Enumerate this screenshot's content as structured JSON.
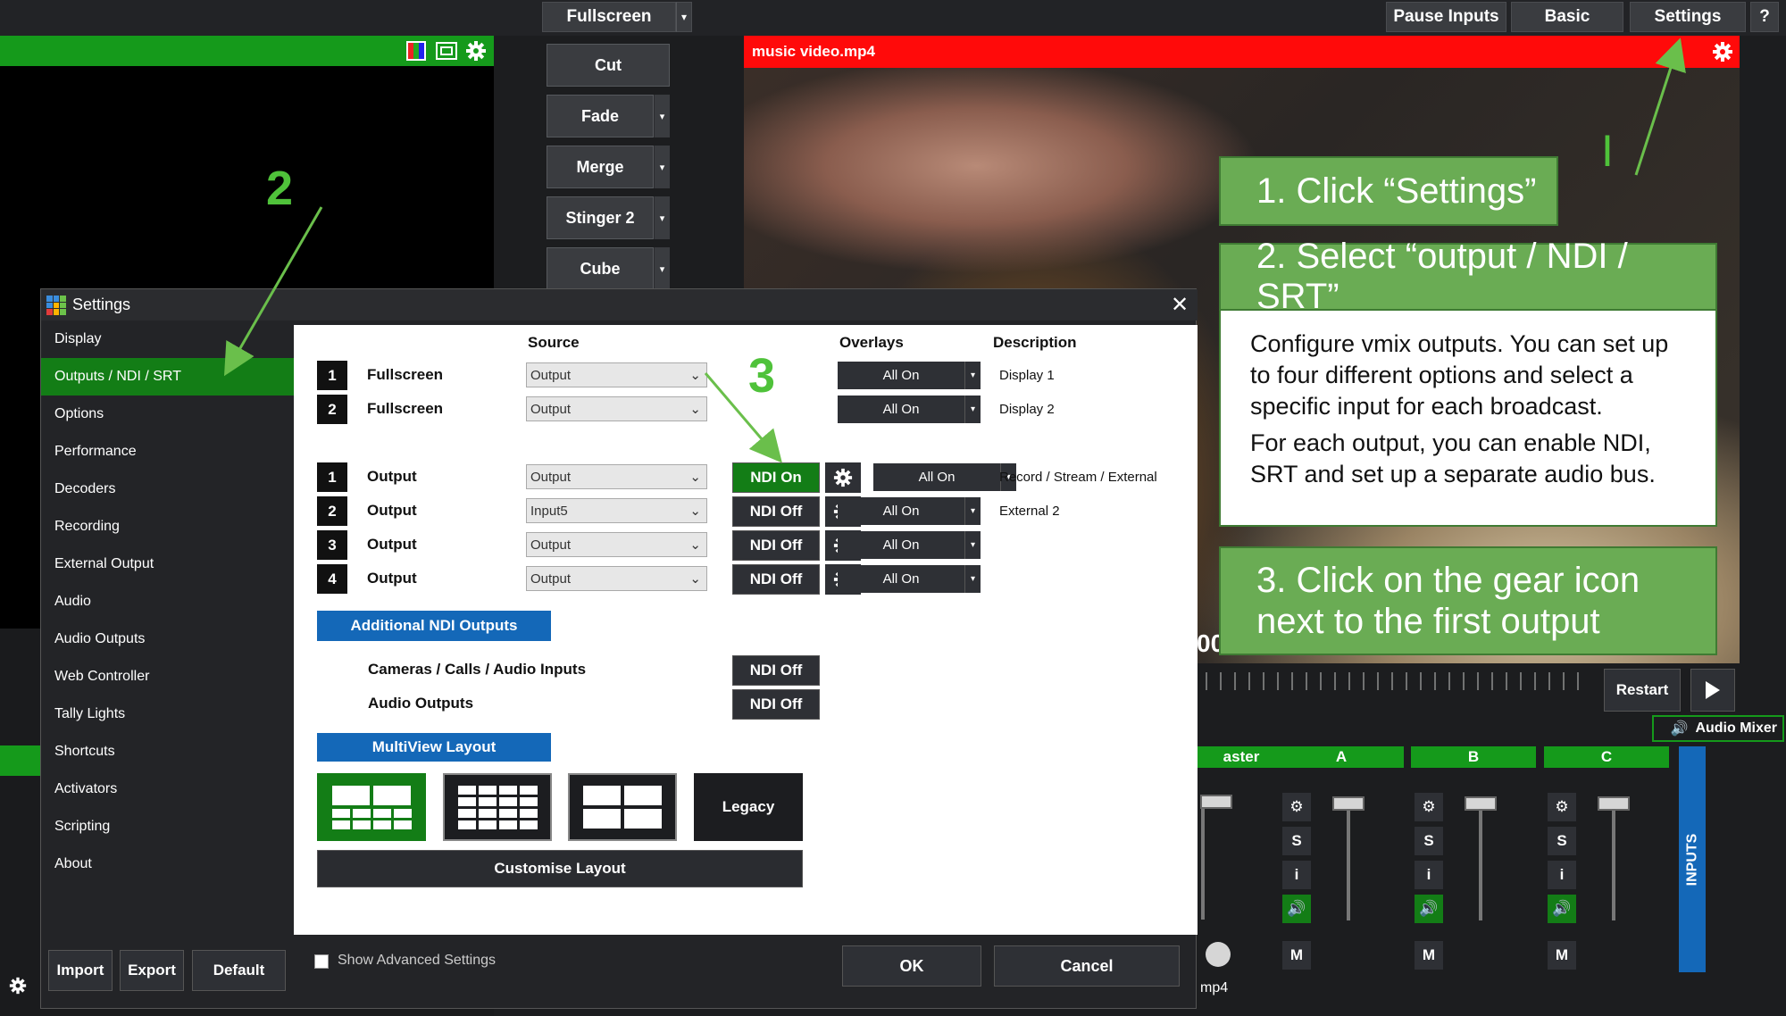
{
  "topbar": {
    "fullscreen_label": "Fullscreen",
    "pause_inputs_label": "Pause Inputs",
    "basic_label": "Basic",
    "settings_label": "Settings",
    "help_label": "?"
  },
  "transitions": [
    "Cut",
    "Fade",
    "Merge",
    "Stinger 2",
    "Cube"
  ],
  "output": {
    "title": "music video.mp4",
    "time_fragment": "00",
    "restart_label": "Restart",
    "audio_mixer_label": "Audio Mixer",
    "bottom_fragment": "mp4"
  },
  "callouts": {
    "step1": "1. Click “Settings”",
    "step2": "2. Select “output / NDI / SRT”",
    "step2_body_1": "Configure vmix outputs. You can set up to four different options and select a specific input for each broadcast.",
    "step2_body_2": "For each output, you can enable NDI, SRT and set up a separate audio bus.",
    "step3": "3. Click on the gear icon next to the first output"
  },
  "markers": {
    "n1": "I",
    "n2": "2",
    "n3": "3"
  },
  "dialog": {
    "title": "Settings",
    "nav": [
      "Display",
      "Outputs / NDI / SRT",
      "Options",
      "Performance",
      "Decoders",
      "Recording",
      "External Output",
      "Audio",
      "Audio Outputs",
      "Web Controller",
      "Tally Lights",
      "Shortcuts",
      "Activators",
      "Scripting",
      "About"
    ],
    "nav_active": "Outputs / NDI / SRT",
    "headers": {
      "source": "Source",
      "overlays": "Overlays",
      "description": "Description"
    },
    "fullscreen_rows": [
      {
        "num": "1",
        "label": "Fullscreen",
        "source": "Output",
        "overlay": "All On",
        "description": "Display 1"
      },
      {
        "num": "2",
        "label": "Fullscreen",
        "source": "Output",
        "overlay": "All On",
        "description": "Display 2"
      }
    ],
    "output_rows": [
      {
        "num": "1",
        "label": "Output",
        "source": "Output",
        "ndi": "NDI On",
        "overlay": "All On",
        "description": "Record / Stream / External"
      },
      {
        "num": "2",
        "label": "Output",
        "source": "Input5",
        "ndi": "NDI Off",
        "overlay": "All On",
        "description": "External 2"
      },
      {
        "num": "3",
        "label": "Output",
        "source": "Output",
        "ndi": "NDI Off",
        "overlay": "All On",
        "description": ""
      },
      {
        "num": "4",
        "label": "Output",
        "source": "Output",
        "ndi": "NDI Off",
        "overlay": "All On",
        "description": ""
      }
    ],
    "additional_ndi_header": "Additional NDI Outputs",
    "cameras_label": "Cameras / Calls / Audio Inputs",
    "cameras_ndi": "NDI Off",
    "audio_outputs_label": "Audio Outputs",
    "audio_outputs_ndi": "NDI Off",
    "multiview_header": "MultiView Layout",
    "legacy_label": "Legacy",
    "customise_label": "Customise Layout",
    "show_advanced_label": "Show Advanced Settings",
    "ok_label": "OK",
    "cancel_label": "Cancel",
    "import_label": "Import",
    "export_label": "Export",
    "default_label": "Default"
  },
  "mixer": {
    "master_fragment": "aster",
    "channels": [
      "A",
      "B",
      "C"
    ],
    "s_label": "S",
    "i_label": "i",
    "m_label": "M",
    "inputs_tab": "INPUTS"
  },
  "colors": {
    "accent_green": "#159a1b",
    "callout_green": "#6aac54",
    "output_red": "#ff0a0a",
    "blue": "#1468b8",
    "arrow_green": "#6abf4b"
  }
}
